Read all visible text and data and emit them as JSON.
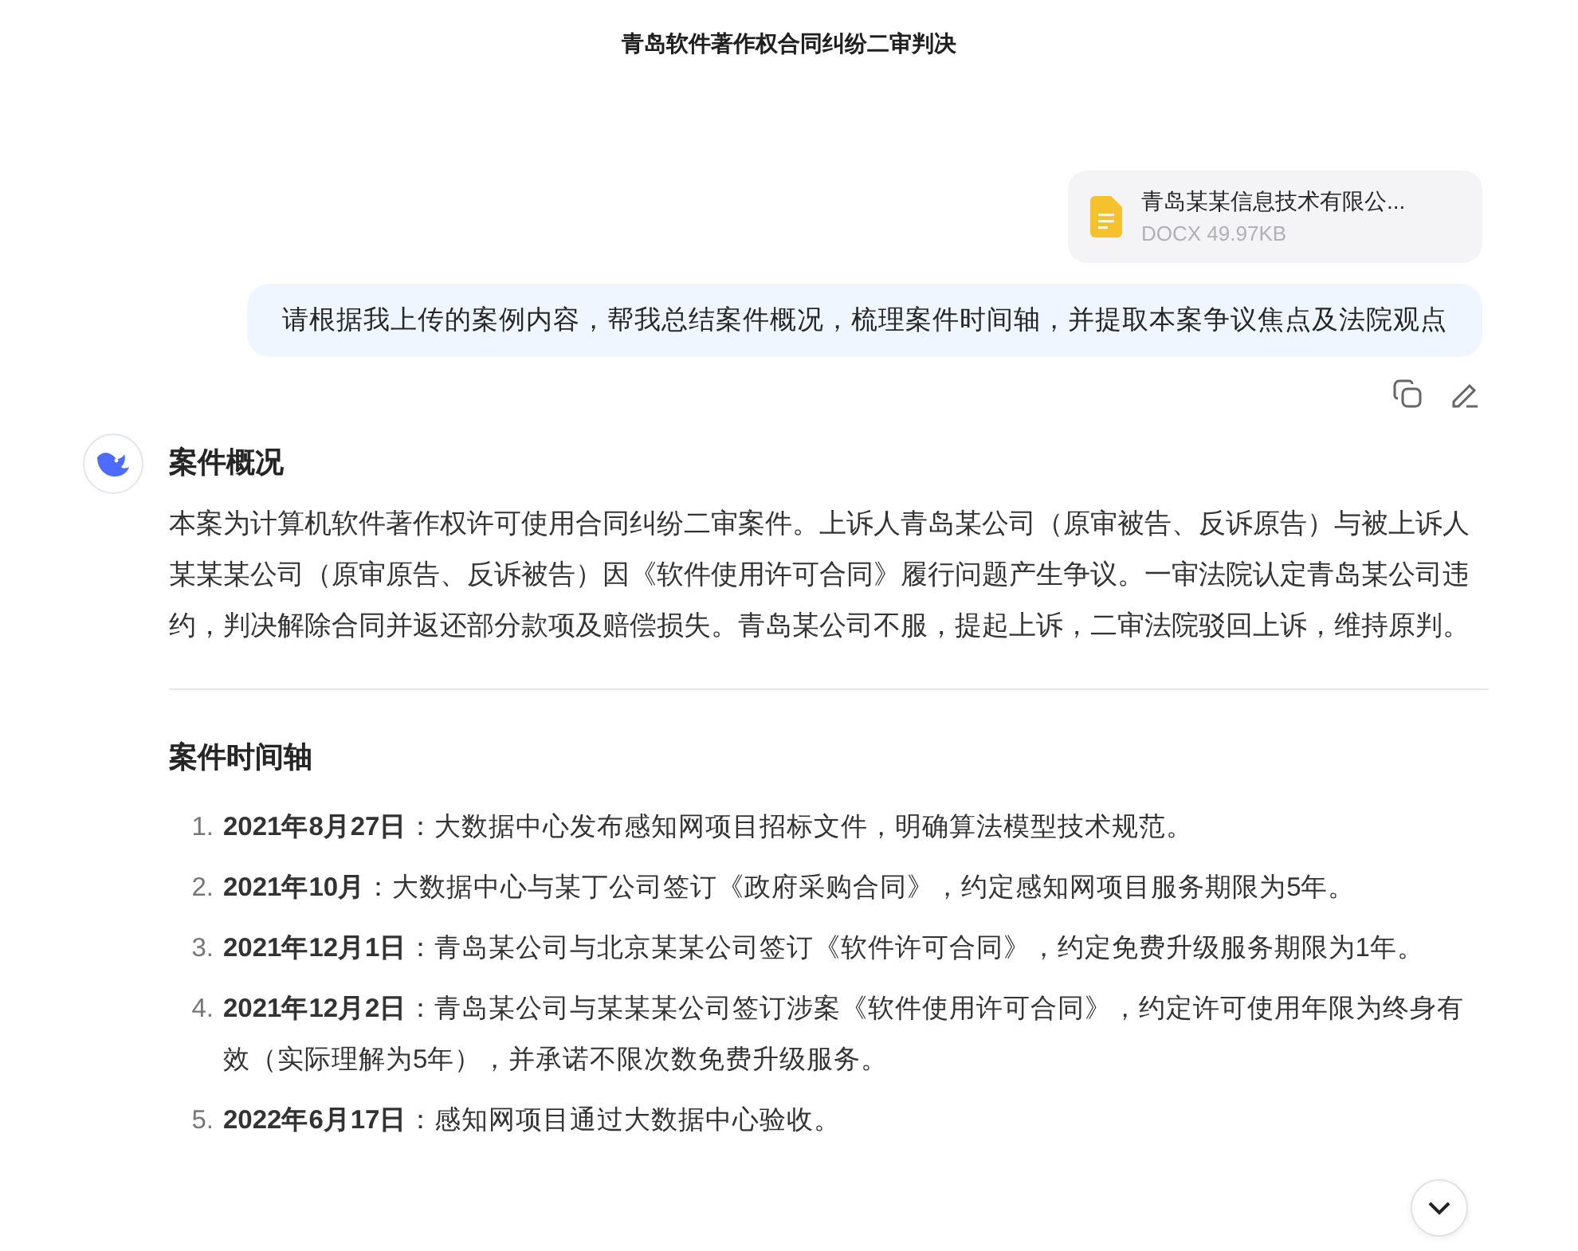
{
  "header": {
    "title": "青岛软件著作权合同纠纷二审判决"
  },
  "attachment": {
    "name": "青岛某某信息技术有限公...",
    "meta": "DOCX 49.97KB"
  },
  "user_message": {
    "text": "请根据我上传的案例内容，帮我总结案件概况，梳理案件时间轴，并提取本案争议焦点及法院观点"
  },
  "answer": {
    "sections": [
      {
        "heading": "案件概况",
        "kind": "paragraph",
        "paragraph": "本案为计算机软件著作权许可使用合同纠纷二审案件。上诉人青岛某公司（原审被告、反诉原告）与被上诉人某某某公司（原审原告、反诉被告）因《软件使用许可合同》履行问题产生争议。一审法院认定青岛某公司违约，判决解除合同并返还部分款项及赔偿损失。青岛某公司不服，提起上诉，二审法院驳回上诉，维持原判。"
      },
      {
        "heading": "案件时间轴",
        "kind": "list",
        "items": [
          {
            "number": "1.",
            "text": "**2021年8月27日**：大数据中心发布感知网项目招标文件，明确算法模型技术规范。"
          },
          {
            "number": "2.",
            "text": "**2021年10月**：大数据中心与某丁公司签订《政府采购合同》，约定感知网项目服务期限为5年。"
          },
          {
            "number": "3.",
            "text": "**2021年12月1日**：青岛某公司与北京某某公司签订《软件许可合同》，约定免费升级服务期限为1年。"
          },
          {
            "number": "4.",
            "text": "**2021年12月2日**：青岛某公司与某某某公司签订涉案《软件使用许可合同》，约定许可使用年限为终身有效（实际理解为5年），并承诺不限次数免费升级服务。"
          },
          {
            "number": "5.",
            "text": "**2022年6月17日**：感知网项目通过大数据中心验收。"
          }
        ]
      }
    ]
  }
}
